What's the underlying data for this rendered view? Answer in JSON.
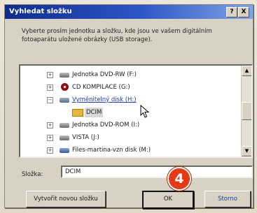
{
  "dialog": {
    "title": "Vyhledat složku",
    "help_button": "?",
    "close_button": "X",
    "instruction": "Vyberte prosím jednotku a složku, kde jsou ve vašem digitálním fotoaparátu uložené obrázky (USB storage)."
  },
  "tree": {
    "items": [
      {
        "label": "Jednotka DVD-RW (F:)",
        "icon": "drive-icon",
        "expander": "+"
      },
      {
        "label": "CD KOMPILACE (G:)",
        "icon": "cd-icon",
        "expander": "+"
      },
      {
        "label": "Vyměnitelný disk (H:)",
        "icon": "usb-drive-icon",
        "expander": "−",
        "selected": true
      },
      {
        "label": "DCIM",
        "icon": "folder-icon",
        "expander": ""
      },
      {
        "label": "Jednotka DVD-ROM (I:)",
        "icon": "drive-icon",
        "expander": "+"
      },
      {
        "label": "VISTA (J:)",
        "icon": "drive-icon",
        "expander": "+"
      },
      {
        "label": "Files-martina-vzn disk (M:)",
        "icon": "network-drive-icon",
        "expander": "+"
      }
    ],
    "scroll_up": "▲",
    "scroll_down": "▼"
  },
  "folder_field": {
    "label": "Složka:",
    "value": "DCIM"
  },
  "buttons": {
    "new_folder": "Vytvořit novou složku",
    "ok": "OK",
    "cancel": "Storno"
  },
  "callout": {
    "number": "4"
  },
  "colors": {
    "titlebar_start": "#0e2c8e",
    "titlebar_end": "#7fa3e6",
    "badge": "#e43a17",
    "selection_text": "#1c3ca8"
  }
}
